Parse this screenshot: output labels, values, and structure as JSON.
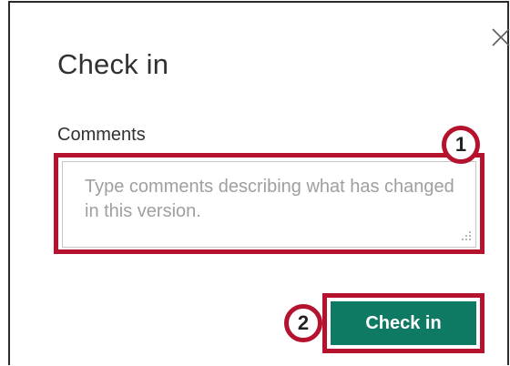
{
  "dialog": {
    "title": "Check in",
    "close_icon": "close-icon"
  },
  "comments": {
    "label": "Comments",
    "placeholder": "Type comments describing what has changed in this version.",
    "value": ""
  },
  "actions": {
    "check_in_label": "Check in"
  },
  "annotations": {
    "step1": "1",
    "step2": "2"
  },
  "colors": {
    "primary_button": "#0f7a64",
    "highlight_border": "#b5122e"
  }
}
